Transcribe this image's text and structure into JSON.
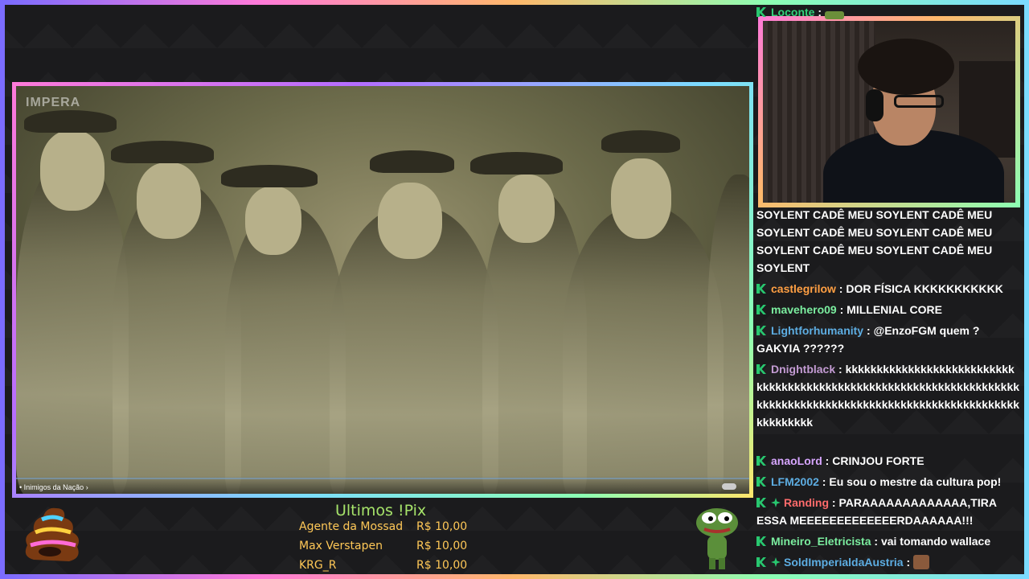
{
  "video": {
    "watermark": "IMPERA",
    "caption": "• Inimigos da Nação ›"
  },
  "chat": {
    "messages": [
      {
        "user": "Loconte",
        "color": "#33d17a",
        "text": "",
        "emote": true,
        "badges": [
          "mod"
        ]
      },
      {
        "user": "",
        "color": "#ffffff",
        "text": "SOYLENT CADÊ MEU SOYLENT CADÊ MEU SOYLENT CADÊ MEU SOYLENT CADÊ MEU SOYLENT CADÊ MEU SOYLENT CADÊ MEU SOYLENT",
        "badges": []
      },
      {
        "user": "castlegrilow",
        "color": "#ff9f43",
        "text": "DOR FÍSICA KKKKKKKKKKK",
        "badges": [
          "mod"
        ]
      },
      {
        "user": "mavehero09",
        "color": "#7bed9f",
        "text": "MILLENIAL CORE",
        "badges": [
          "mod"
        ]
      },
      {
        "user": "Lightforhumanity",
        "color": "#5dade2",
        "text": "@EnzoFGM quem ? GAKYIA ??????",
        "badges": [
          "mod"
        ]
      },
      {
        "user": "Dnightblack",
        "color": "#c39bd3",
        "text": "kkkkkkkkkkkkkkkkkkkkkkkkkkkkkkkkkkkkkkkkkkkkkkkkkkkkkkkkkkkkkkkkkkkkkkkkkkkkkkkkkkkkkkkkkkkkkkkkkkkkkkkkkkkkkkkkkkkkkkkk",
        "badges": [
          "mod"
        ]
      },
      {
        "user": "anaoLord",
        "color": "#d7a6ff",
        "text": "CRINJOU FORTE",
        "badges": [
          "mod"
        ]
      },
      {
        "user": "LFM2002",
        "color": "#5dade2",
        "text": "Eu sou o mestre da cultura pop!",
        "badges": [
          "mod"
        ]
      },
      {
        "user": "Randing",
        "color": "#ff6b6b",
        "text": "PARAAAAAAAAAAAAA,TIRA ESSA MEEEEEEEEEEEEERDAAAAAA!!!",
        "badges": [
          "mod",
          "sub"
        ]
      },
      {
        "user": "Mineiro_Eletricista",
        "color": "#7bed9f",
        "text": "vai tomando wallace",
        "badges": [
          "mod"
        ]
      },
      {
        "user": "SoldImperialdaAustria",
        "color": "#5dade2",
        "text": "",
        "emote": true,
        "badges": [
          "mod",
          "sub"
        ]
      }
    ]
  },
  "pix": {
    "title": "Ultimos !Pix",
    "rows": [
      {
        "name": "Agente da Mossad",
        "amount": "R$ 10,00"
      },
      {
        "name": "Max Verstapen",
        "amount": "R$ 10,00"
      },
      {
        "name": "KRG_R",
        "amount": "R$ 10,00"
      }
    ]
  },
  "colors": {
    "accent_gradient": [
      "#7b6cff",
      "#ff7ad9",
      "#ffb86b",
      "#8cffb4",
      "#7bdcff"
    ],
    "mod_badge": "#28c76f",
    "pix_title": "#a6e36a",
    "pix_text": "#ffc857"
  }
}
